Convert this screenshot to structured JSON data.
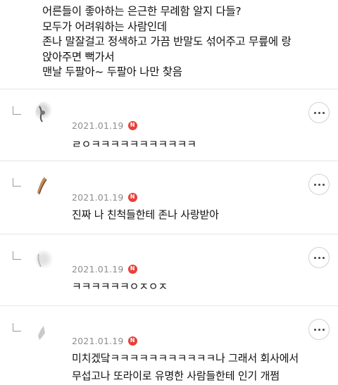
{
  "post": {
    "lines": [
      "어른들이 좋아하는 은근한 무례함 알지 다들?",
      "모두가 어려워하는 사람인데",
      "존나 말잘걸고 정색하고 가끔 반말도 섞어주고 무릎에 랑",
      "앉아주면 뻑가서",
      "맨날 두팔아~ 두팔아 나만 찾음"
    ]
  },
  "comments": [
    {
      "date": "2021.01.19",
      "badge": "N",
      "lines": [
        "ㄹㅇㅋㅋㅋㅋㅋㅋㅋㅋㅋㅋㅋ"
      ]
    },
    {
      "date": "2021.01.19",
      "badge": "N",
      "lines": [
        "진짜 나 친척들한테 존나 사랑받아"
      ]
    },
    {
      "date": "2021.01.19",
      "badge": "N",
      "lines": [
        "ㅋㅋㅋㅋㅋㅋㅇㅈㅇㅈ"
      ]
    },
    {
      "date": "2021.01.19",
      "badge": "N",
      "lines": [
        "미치겠닼ㅋㅋㅋㅋㅋㅋㅋㅋㅋㅋㅋ나 그래서 회사에서",
        "무섭고나 또라이로 유명한 사람들한테 인기 개쩜"
      ]
    }
  ],
  "icons": {
    "reply": "reply-arrow-icon",
    "more": "more-options-icon",
    "badge": "new-badge-icon"
  },
  "colors": {
    "badge": "#e8403a",
    "date": "#8e8e8e",
    "separator": "#e6e6e6"
  }
}
